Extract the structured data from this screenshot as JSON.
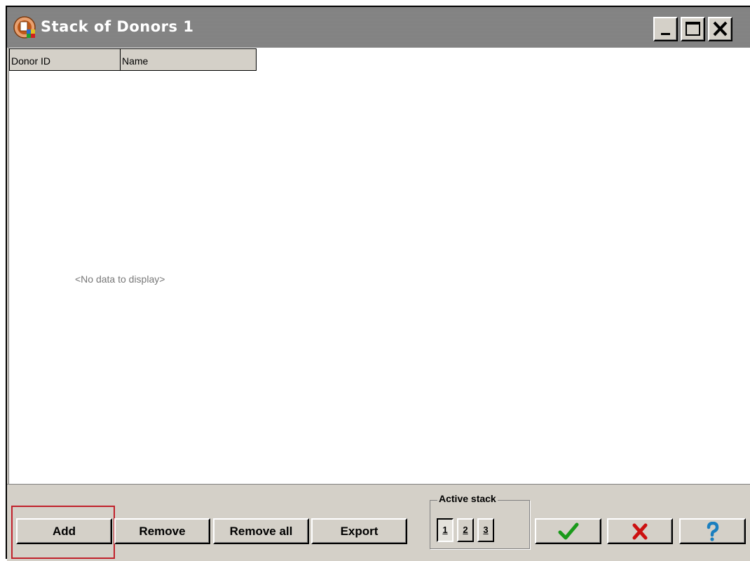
{
  "window": {
    "title": "Stack of Donors 1",
    "icons": {
      "app": "donor-app-icon",
      "minimize": "minimize-icon",
      "maximize": "maximize-icon",
      "close": "close-icon"
    }
  },
  "grid": {
    "columns": [
      "Donor ID",
      "Name"
    ],
    "rows": [],
    "empty_message": "<No data to display>"
  },
  "toolbar": {
    "add_label": "Add",
    "remove_label": "Remove",
    "remove_all_label": "Remove all",
    "export_label": "Export",
    "active_stack": {
      "label": "Active stack",
      "options": [
        "1",
        "2",
        "3"
      ],
      "selected": "1"
    },
    "ok_icon": "checkmark-icon",
    "cancel_icon": "red-x-icon",
    "help_icon": "question-mark-icon",
    "highlighted": "Add"
  },
  "colors": {
    "title_bar": "#808080",
    "highlight_border": "#c0202a",
    "ok": "#1a9a1a",
    "cancel": "#cc1111",
    "help": "#1b7fbf"
  }
}
